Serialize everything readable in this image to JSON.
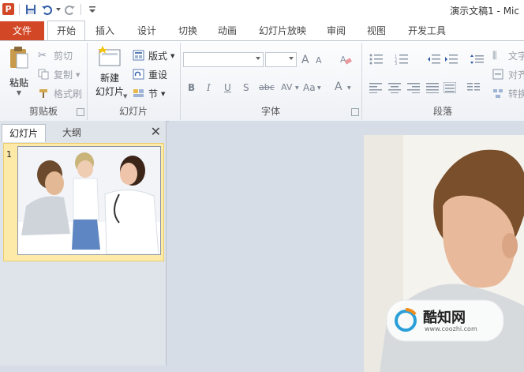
{
  "titlebar": {
    "title": "演示文稿1 - Mic"
  },
  "tabs": [
    {
      "label": "文件"
    },
    {
      "label": "开始"
    },
    {
      "label": "插入"
    },
    {
      "label": "设计"
    },
    {
      "label": "切换"
    },
    {
      "label": "动画"
    },
    {
      "label": "幻灯片放映"
    },
    {
      "label": "审阅"
    },
    {
      "label": "视图"
    },
    {
      "label": "开发工具"
    }
  ],
  "ribbon": {
    "clipboard": {
      "paste": "粘贴",
      "cut": "剪切",
      "copy": "复制",
      "format_painter": "格式刷",
      "label": "剪贴板"
    },
    "slides": {
      "new_slide_line1": "新建",
      "new_slide_line2": "幻灯片",
      "layout": "版式",
      "reset": "重设",
      "section": "节",
      "label": "幻灯片"
    },
    "font": {
      "label": "字体",
      "font_size_up": "A",
      "font_size_down": "A",
      "bold": "B",
      "italic": "I",
      "underline": "U",
      "strike": "S",
      "shadow": "abc",
      "spacing": "AV",
      "case": "Aa",
      "color": "A"
    },
    "paragraph": {
      "label": "段落",
      "text_dir": "文字",
      "align_text": "对齐",
      "convert": "转换"
    }
  },
  "left_pane": {
    "tab_slides": "幻灯片",
    "tab_outline": "大纲",
    "close": "✕",
    "slide_number": "1"
  },
  "watermark": {
    "brand": "酷知网",
    "url": "www.coozhi.com"
  },
  "colors": {
    "file_tab": "#d24726",
    "accent": "#d24726",
    "selection": "#fde9a8"
  }
}
